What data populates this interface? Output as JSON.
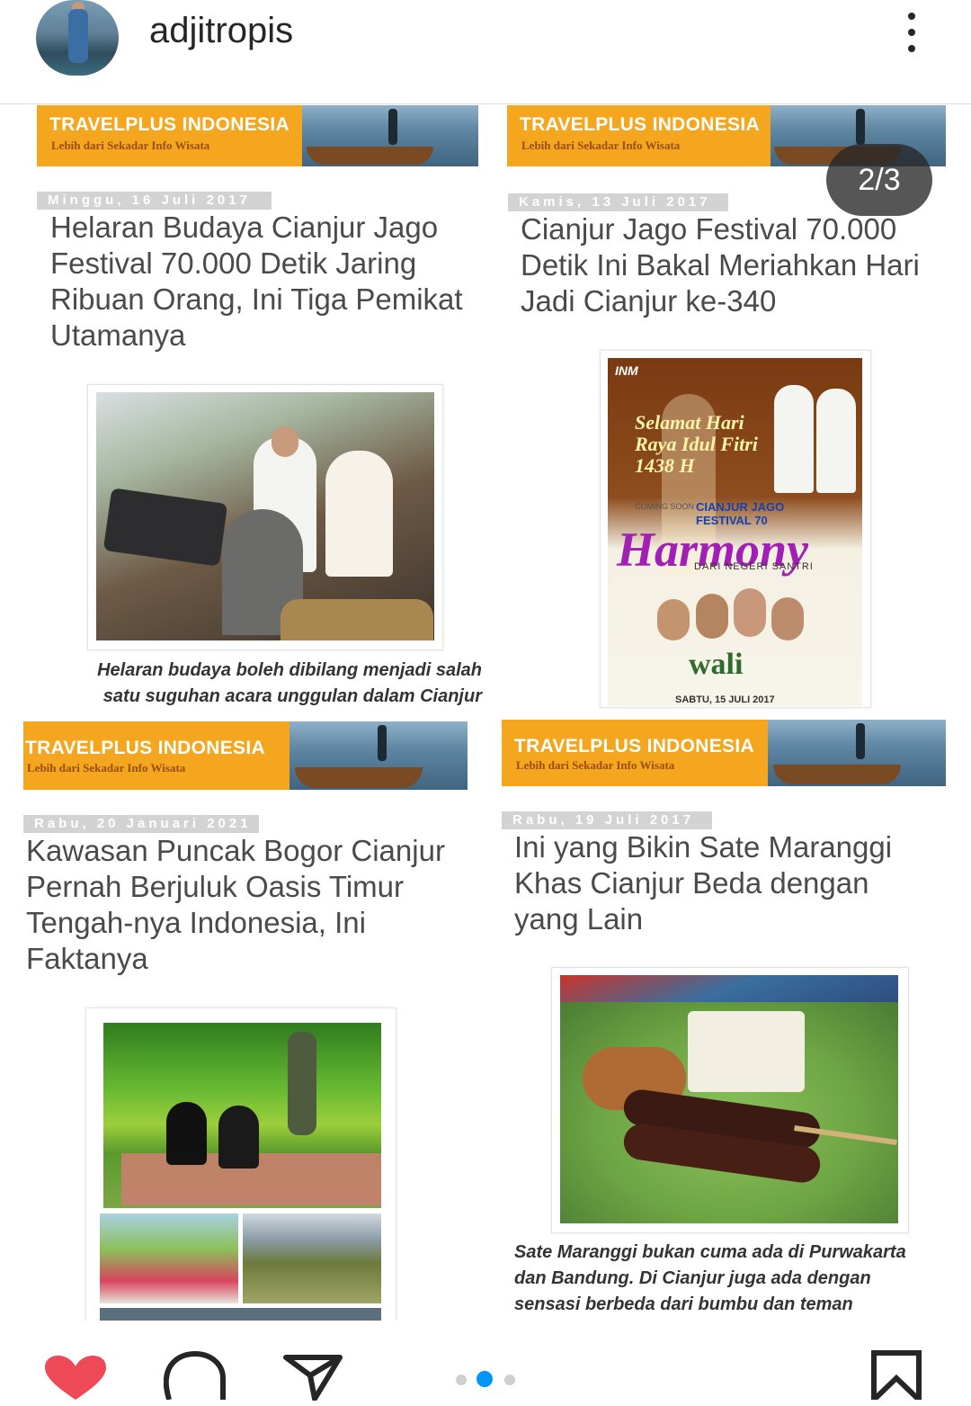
{
  "header": {
    "username": "adjitropis"
  },
  "carousel": {
    "counter": "2/3",
    "total_dots": 3,
    "active_dot": 2
  },
  "posts": [
    {
      "banner_title": "TRAVELPLUS INDONESIA",
      "banner_subtitle": "Lebih dari Sekadar Info Wisata",
      "date": "Minggu, 16 Juli 2017",
      "title": "Helaran Budaya Cianjur Jago Festival 70.000 Detik Jaring Ribuan Orang, Ini Tiga Pemikat Utamanya",
      "caption": "Helaran budaya boleh dibilang menjadi salah satu suguhan acara unggulan dalam Cianjur"
    },
    {
      "banner_title": "TRAVELPLUS INDONESIA",
      "banner_subtitle": "Lebih dari Sekadar Info Wisata",
      "date": "Kamis, 13 Juli 2017",
      "title": "Cianjur Jago Festival 70.000 Detik Ini Bakal Meriahkan Hari Jadi Cianjur ke-340",
      "poster": {
        "top_left": "INM",
        "greeting": "Selamat Hari Raya Idul Fitri 1438 H",
        "coming_soon": "COMING SOON",
        "festival": "CIANJUR JAGO FESTIVAL 70",
        "harmony": "Harmony",
        "dari": "DARI NEGERI SANTRI",
        "band": "wali",
        "footer": "SABTU, 15 JULI 2017"
      }
    },
    {
      "banner_title": "TRAVELPLUS INDONESIA",
      "banner_subtitle": "Lebih dari Sekadar Info Wisata",
      "date": "Rabu, 20 Januari 2021",
      "title": "Kawasan Puncak Bogor Cianjur Pernah Berjuluk Oasis Timur Tengah-nya Indonesia, Ini Faktanya"
    },
    {
      "banner_title": "TRAVELPLUS INDONESIA",
      "banner_subtitle": "Lebih dari Sekadar Info Wisata",
      "date": "Rabu, 19 Juli 2017",
      "title": "Ini yang Bikin Sate Maranggi Khas Cianjur Beda dengan yang Lain",
      "caption": "Sate Maranggi bukan cuma ada di Purwakarta dan Bandung. Di Cianjur juga ada dengan sensasi berbeda dari bumbu dan teman"
    }
  ],
  "actions": {
    "like_color": "#ed4956"
  }
}
